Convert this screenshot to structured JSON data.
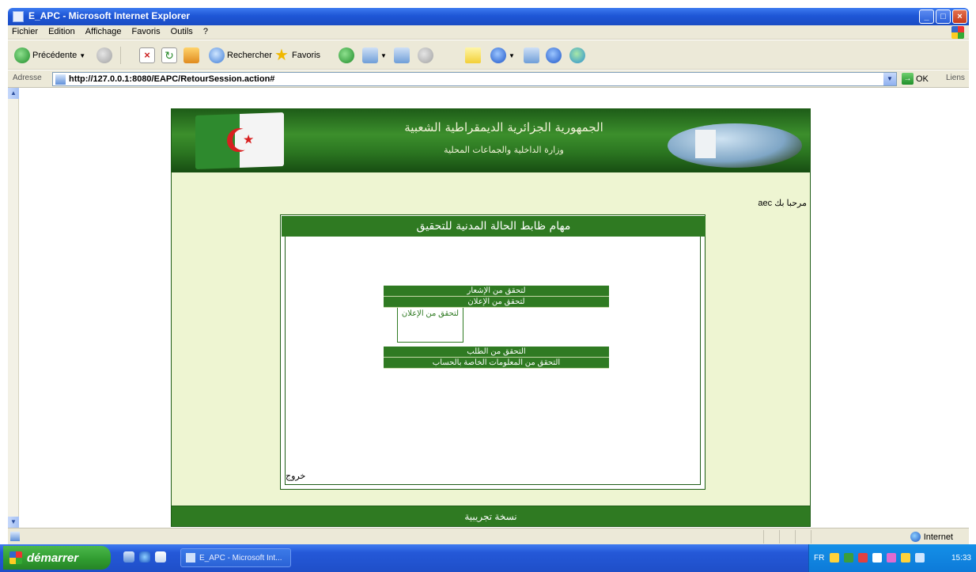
{
  "window": {
    "title": "E_APC - Microsoft Internet Explorer"
  },
  "menubar": {
    "items": [
      "Fichier",
      "Edition",
      "Affichage",
      "Favoris",
      "Outils",
      "?"
    ]
  },
  "toolbar": {
    "back_label": "Précédente",
    "search_label": "Rechercher",
    "favorites_label": "Favoris"
  },
  "addressbar": {
    "label": "Adresse",
    "url": "http://127.0.0.1:8080/EAPC/RetourSession.action#",
    "go_label": "OK",
    "links_label": "Liens"
  },
  "site": {
    "header_title": "الجمهورية الجزائرية الديمقراطية الشعبية",
    "header_subtitle": "وزارة الداخلية والجماعات المحلية",
    "welcome_text": "مرحبا بك",
    "welcome_user": "aec",
    "panel_title": "مهام ظابط الحالة المدنية للتحقيق",
    "menu": {
      "item1": "لتحقق من الإشعار",
      "item2": "لتحقق من الإعلان",
      "submenu_item": "لتحقق من الإعلان",
      "item3": "التحقق من الطلب",
      "item4": "التحقق من المعلومات الخاصة بالحساب"
    },
    "exit_label": "خروج",
    "footer_text": "نسخة تجريبية"
  },
  "statusbar": {
    "zone_label": "Internet"
  },
  "taskbar": {
    "start_label": "démarrer",
    "task_label": "E_APC - Microsoft Int...",
    "lang": "FR",
    "clock": "15:33"
  },
  "colors": {
    "site_green": "#2f7a22",
    "site_bg": "#eef5d2",
    "xp_blue": "#2458d8",
    "start_green": "#2f9a2f"
  }
}
